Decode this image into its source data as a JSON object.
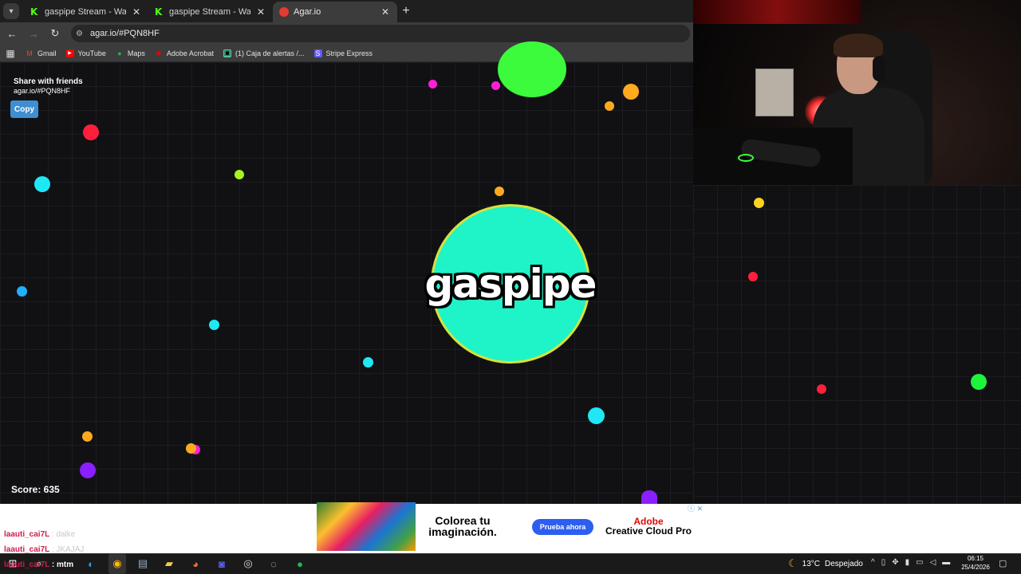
{
  "browser": {
    "tabs": [
      {
        "title": "gaspipe Stream - Watch Live on",
        "favicon": "kick-icon",
        "active": false
      },
      {
        "title": "gaspipe Stream - Watch Live on",
        "favicon": "kick-icon",
        "active": false
      },
      {
        "title": "Agar.io",
        "favicon": "agar-icon",
        "active": true
      }
    ],
    "new_tab": "+",
    "url": "agar.io/#PQN8HF",
    "bookmarks": [
      "Gmail",
      "YouTube",
      "Maps",
      "Adobe Acrobat",
      "(1) Caja de alertas /...",
      "Stripe Express"
    ]
  },
  "game": {
    "share_title": "Share with friends",
    "share_url": "agar.io/#PQN8HF",
    "copy_label": "Copy",
    "score_text": "Score: 635",
    "player_name": "gaspipe",
    "player_color": "#1ff4c8",
    "virus_color": "#3cfa3c"
  },
  "ad": {
    "headline": "Colorea tu imaginación.",
    "cta": "Prueba ahora",
    "brand_line1": "Adobe",
    "brand_line2": "Creative Cloud Pro",
    "info": "ⓘ ✕"
  },
  "chat": [
    {
      "user": "laauti_cai7L",
      "message": ": dalke"
    },
    {
      "user": "laauti_cai7L",
      "message": ": JKAJAJ"
    },
    {
      "user": "laauti_cai7L",
      "message": ": mtm"
    }
  ],
  "taskbar": {
    "weather_temp": "13°C",
    "weather_text": "Despejado",
    "time": "06:15",
    "date": "25/4/2026"
  },
  "colors": {
    "pellet_magenta": "#ff1fd4",
    "pellet_orange": "#ffa91f",
    "pellet_red": "#ff1f3c",
    "pellet_cyan": "#1fe8f4",
    "pellet_lime": "#a8f41f",
    "pellet_yellow": "#ffd21f",
    "pellet_blue": "#1fb0ff",
    "pellet_green": "#1ff43c",
    "pellet_purple": "#8a1fff",
    "copy_button": "#3f8fd0",
    "ad_cta": "#2c5ef0",
    "adobe_red": "#e10600"
  }
}
